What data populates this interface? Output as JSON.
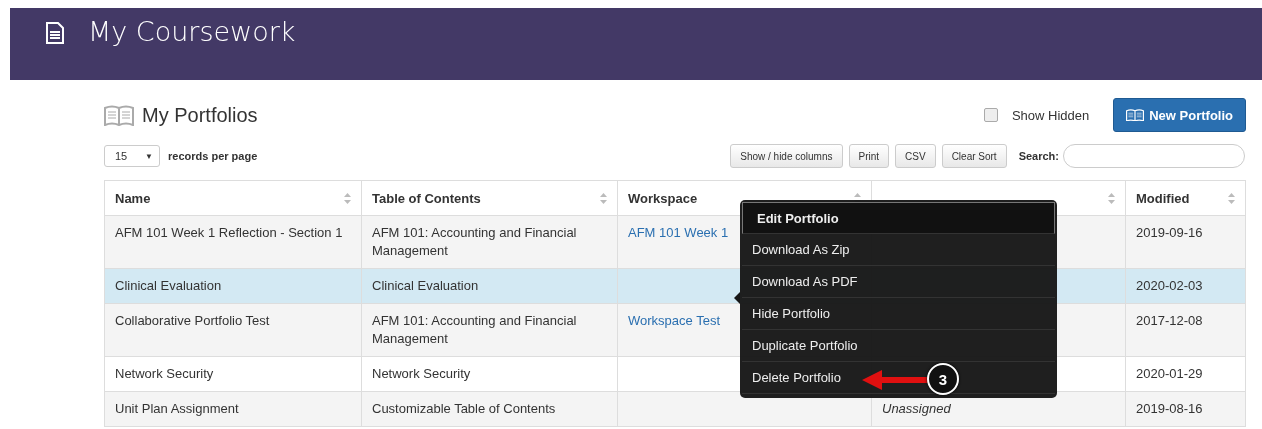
{
  "header": {
    "title": "My Coursework"
  },
  "portfolios": {
    "title": "My Portfolios",
    "show_hidden": {
      "label": "Show Hidden",
      "checked": false
    },
    "new_button": "New Portfolio"
  },
  "toolbar": {
    "page_size": "15",
    "page_size_caret": "▼",
    "page_size_label": "records per page",
    "buttons": [
      "Show / hide columns",
      "Print",
      "CSV",
      "Clear Sort"
    ],
    "search_label": "Search:"
  },
  "table": {
    "columns": [
      {
        "label": "Name"
      },
      {
        "label": "Table of Contents"
      },
      {
        "label": "Workspace"
      },
      {},
      {
        "label": "Modified"
      }
    ],
    "rows": [
      {
        "name": "AFM 101 Week 1 Reflection - Section 1",
        "toc": "AFM 101: Accounting and Financial Management",
        "workspace": "AFM 101 Week 1",
        "modified": "2019-09-16",
        "selected": false
      },
      {
        "name": "Clinical Evaluation",
        "toc": "Clinical Evaluation",
        "modified": "2020-02-03",
        "selected": true
      },
      {
        "name": "Collaborative Portfolio Test",
        "toc": "AFM 101: Accounting and Financial Management",
        "workspace": "Workspace Test",
        "modified": "2017-12-08",
        "selected": false
      },
      {
        "name": "Network Security",
        "toc": "Network Security",
        "modified": "2020-01-29",
        "selected": false
      },
      {
        "name": "Unit Plan Assignment",
        "toc": "Customizable Table of Contents",
        "department": "Unassigned",
        "modified": "2019-08-16",
        "selected": false
      }
    ]
  },
  "menu": {
    "items": [
      {
        "label": "Edit Portfolio",
        "selected": true
      },
      {
        "label": "Download As Zip",
        "selected": false
      },
      {
        "label": "Download As PDF",
        "selected": false
      },
      {
        "label": "Hide Portfolio",
        "selected": false
      },
      {
        "label": "Duplicate Portfolio",
        "selected": false
      },
      {
        "label": "Delete Portfolio",
        "selected": false
      }
    ]
  },
  "callout": {
    "number": "3"
  }
}
